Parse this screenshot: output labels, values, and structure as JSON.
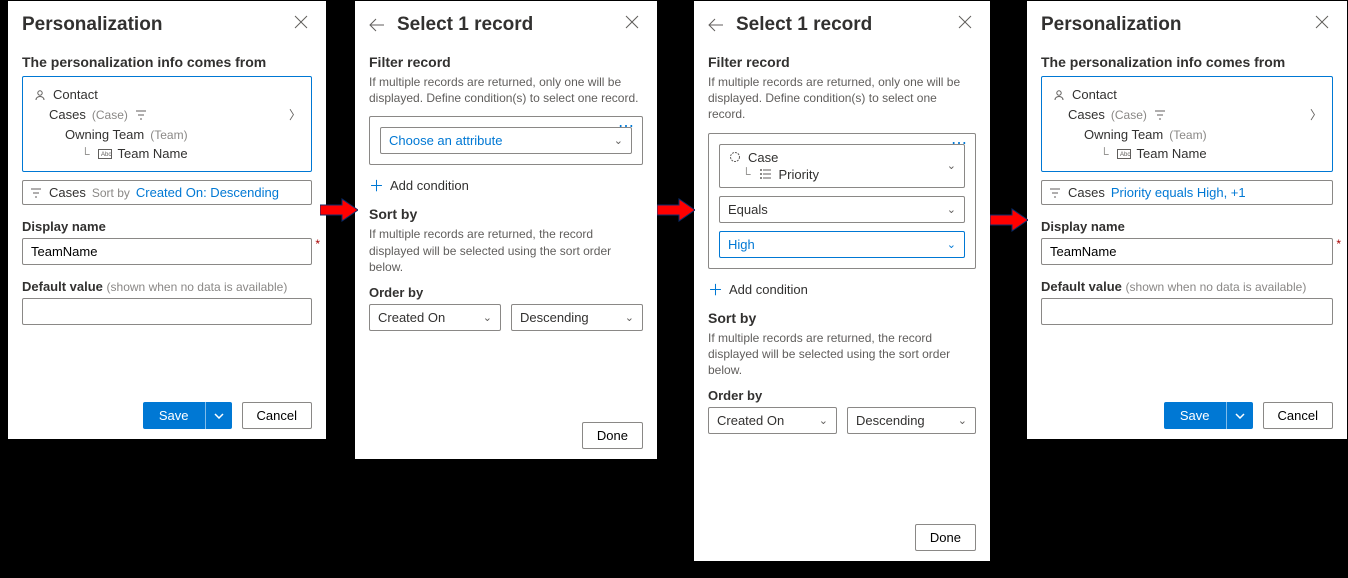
{
  "panel1": {
    "title": "Personalization",
    "comesFrom": "The personalization info comes from",
    "tree": {
      "contact": "Contact",
      "cases": "Cases",
      "casesEntity": "(Case)",
      "owningTeam": "Owning Team",
      "owningTeamEntity": "(Team)",
      "teamName": "Team Name"
    },
    "filter": {
      "prefix": "Cases",
      "sortby": "Sort by",
      "link": "Created On: Descending"
    },
    "displayName": "Display name",
    "displayNameVal": "TeamName",
    "defaultValue": "Default value",
    "defaultValueHint": "(shown when no data is available)",
    "save": "Save",
    "cancel": "Cancel"
  },
  "panel2": {
    "title": "Select 1 record",
    "filterRecord": "Filter record",
    "filterDesc": "If multiple records are returned, only one will be displayed. Define condition(s) to select one record.",
    "choose": "Choose an attribute",
    "addCondition": "Add condition",
    "sortBy": "Sort by",
    "sortDesc": "If multiple records are returned, the record displayed will be selected using the sort order below.",
    "orderBy": "Order by",
    "orderField": "Created On",
    "orderDir": "Descending",
    "done": "Done"
  },
  "panel3": {
    "title": "Select 1 record",
    "filterRecord": "Filter record",
    "filterDesc": "If multiple records are returned, only one will be displayed. Define condition(s) to select one record.",
    "attrEntity": "Case",
    "attrField": "Priority",
    "operator": "Equals",
    "value": "High",
    "addCondition": "Add condition",
    "sortBy": "Sort by",
    "sortDesc": "If multiple records are returned, the record displayed will be selected using the sort order below.",
    "orderBy": "Order by",
    "orderField": "Created On",
    "orderDir": "Descending",
    "done": "Done"
  },
  "panel4": {
    "title": "Personalization",
    "comesFrom": "The personalization info comes from",
    "tree": {
      "contact": "Contact",
      "cases": "Cases",
      "casesEntity": "(Case)",
      "owningTeam": "Owning Team",
      "owningTeamEntity": "(Team)",
      "teamName": "Team Name"
    },
    "filter": {
      "prefix": "Cases",
      "link": "Priority equals High, +1"
    },
    "displayName": "Display name",
    "displayNameVal": "TeamName",
    "defaultValue": "Default value",
    "defaultValueHint": "(shown when no data is available)",
    "save": "Save",
    "cancel": "Cancel"
  }
}
